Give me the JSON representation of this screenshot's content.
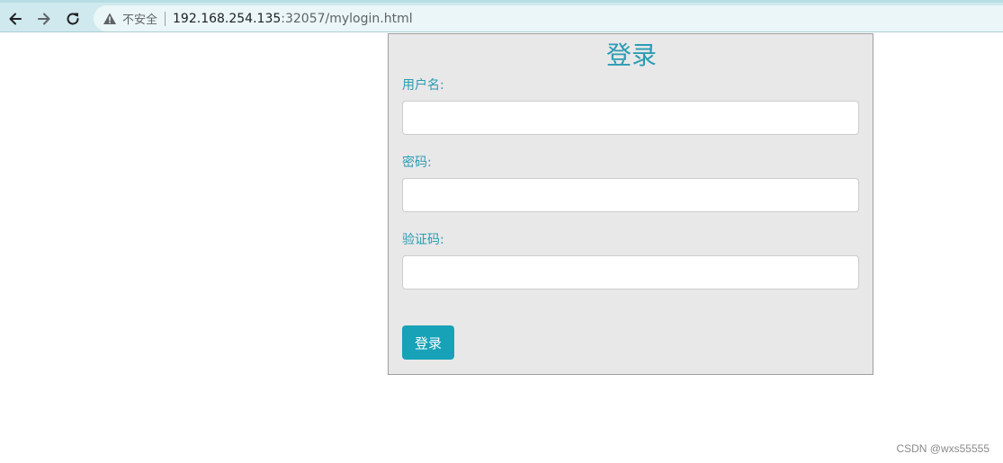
{
  "browser": {
    "security_label": "不安全",
    "url_host": "192.168.254.135",
    "url_rest": ":32057/mylogin.html",
    "icons": [
      "back-arrow-icon",
      "forward-arrow-icon",
      "reload-icon",
      "warning-triangle-icon"
    ]
  },
  "login": {
    "title": "登录",
    "username_label": "用户名:",
    "username_value": "",
    "password_label": "密码:",
    "password_value": "",
    "captcha_label": "验证码:",
    "captcha_value": "",
    "submit_label": "登录"
  },
  "watermark": "CSDN @wxs55555",
  "colors": {
    "accent": "#17a2b8",
    "label": "#2a9cb3",
    "panel_bg": "#e8e8e8",
    "toolbar_bg": "#cfe9ee"
  }
}
